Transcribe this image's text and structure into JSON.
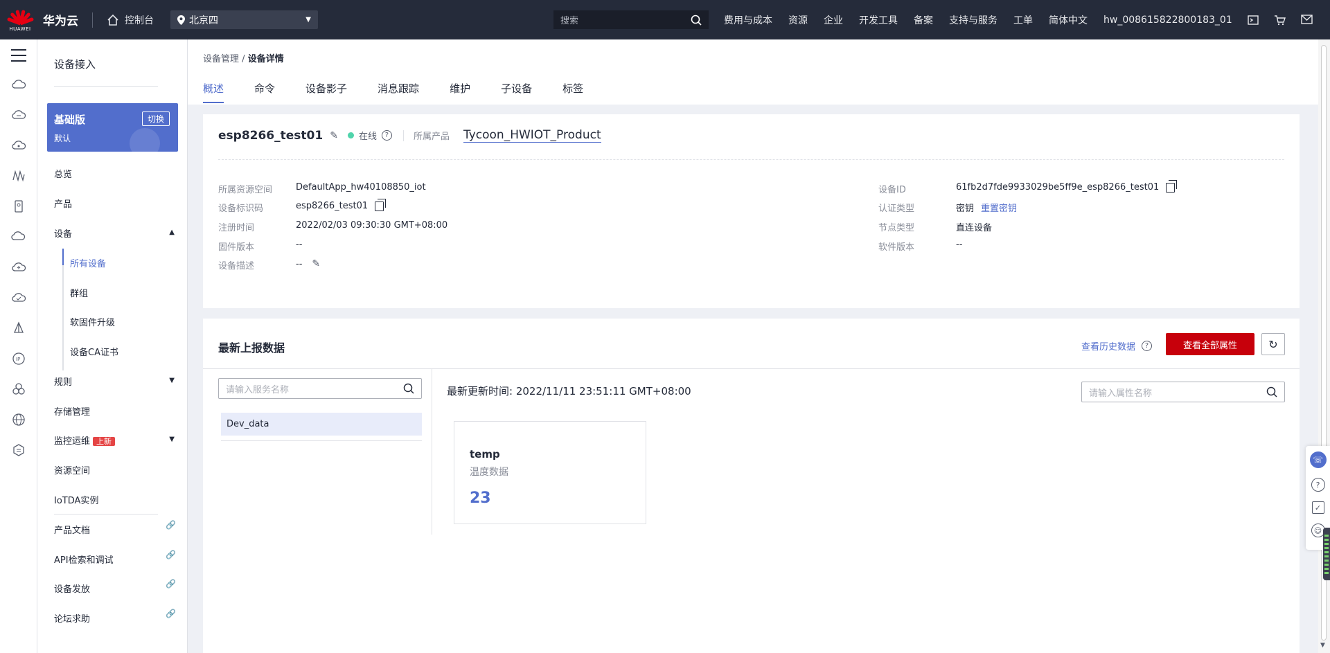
{
  "topbar": {
    "logo_text": "HUAWEI",
    "brand": "华为云",
    "console": "控制台",
    "region": "北京四",
    "search_placeholder": "搜索",
    "nav": [
      "费用与成本",
      "资源",
      "企业",
      "开发工具",
      "备案",
      "支持与服务",
      "工单",
      "简体中文",
      "hw_008615822800183_01"
    ]
  },
  "sidebar": {
    "title": "设备接入",
    "edition": {
      "name": "基础版",
      "sub": "默认",
      "switch": "切换"
    },
    "items": {
      "overview": "总览",
      "product": "产品",
      "device": "设备",
      "all_devices": "所有设备",
      "group": "群组",
      "firmware": "软固件升级",
      "ca_cert": "设备CA证书",
      "rules": "规则",
      "storage": "存储管理",
      "monitor": "监控运维",
      "monitor_badge": "上新",
      "resource_space": "资源空间",
      "iotda_instance": "IoTDA实例",
      "docs": "产品文档",
      "api": "API检索和调试",
      "provision": "设备发放",
      "forum": "论坛求助"
    }
  },
  "breadcrumb": {
    "parent": "设备管理",
    "sep": "/",
    "current": "设备详情"
  },
  "tabs": [
    "概述",
    "命令",
    "设备影子",
    "消息跟踪",
    "维护",
    "子设备",
    "标签"
  ],
  "device": {
    "name": "esp8266_test01",
    "status": "在线",
    "product_label": "所属产品",
    "product": "Tycoon_HWIOT_Product",
    "fields_left": [
      {
        "k": "所属资源空间",
        "v": "DefaultApp_hw40108850_iot"
      },
      {
        "k": "设备标识码",
        "v": "esp8266_test01"
      },
      {
        "k": "注册时间",
        "v": "2022/02/03 09:30:30 GMT+08:00"
      },
      {
        "k": "固件版本",
        "v": "--"
      },
      {
        "k": "设备描述",
        "v": "--"
      }
    ],
    "fields_right": [
      {
        "k": "设备ID",
        "v": "61fb2d7fde9933029be5ff9e_esp8266_test01"
      },
      {
        "k": "认证类型",
        "v": "密钥",
        "link": "重置密钥"
      },
      {
        "k": "节点类型",
        "v": "直连设备"
      },
      {
        "k": "软件版本",
        "v": "--"
      }
    ]
  },
  "report": {
    "title": "最新上报数据",
    "history": "查看历史数据",
    "view_all": "查看全部属性",
    "service_placeholder": "请输入服务名称",
    "service_item": "Dev_data",
    "update_time": "最新更新时间:   2022/11/11 23:51:11 GMT+08:00",
    "prop_placeholder": "请输入属性名称",
    "property": {
      "name": "temp",
      "desc": "温度数据",
      "value": "23"
    }
  }
}
